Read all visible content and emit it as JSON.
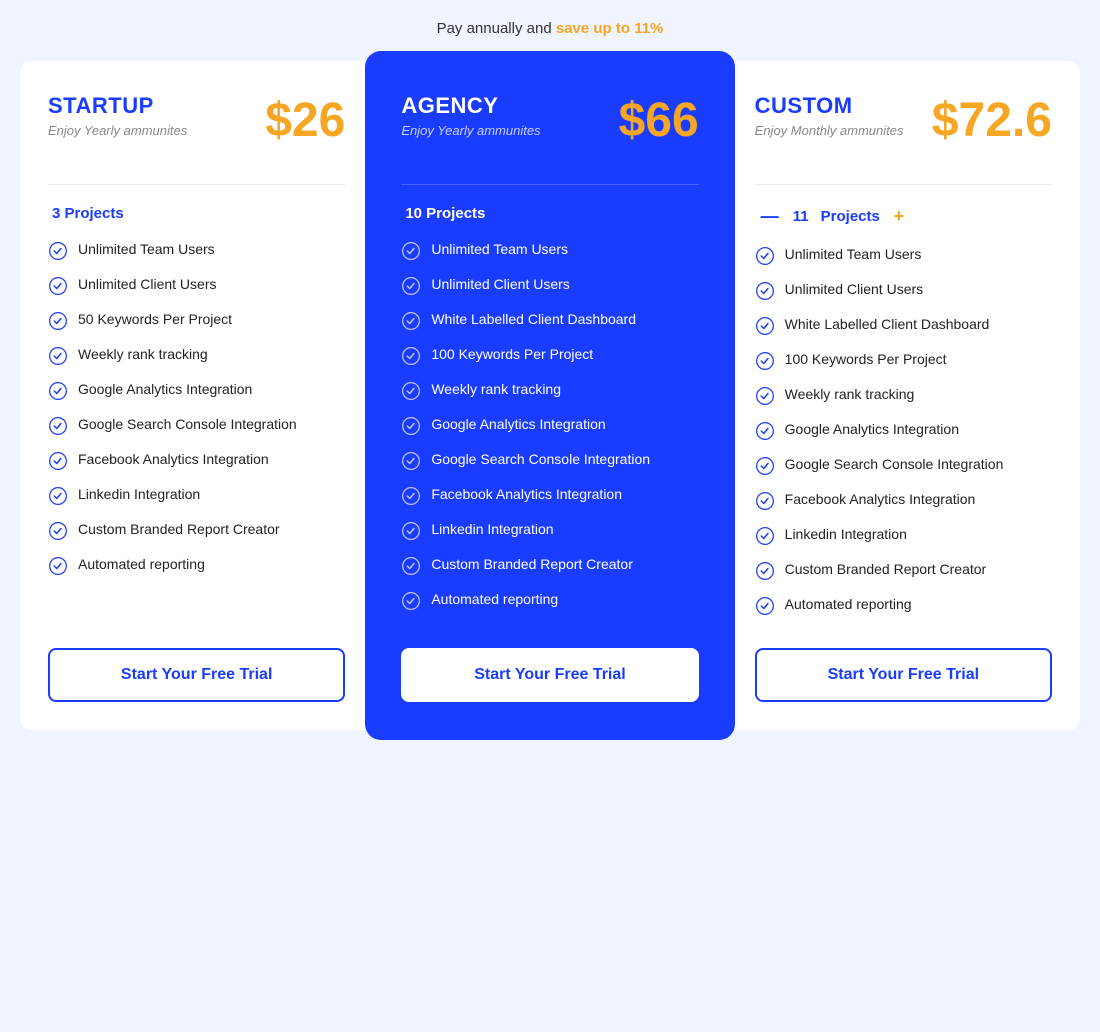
{
  "topbar": {
    "text": "Pay annually and",
    "save_text": "save up to 11%"
  },
  "plans": [
    {
      "id": "startup",
      "name": "STARTUP",
      "subtitle": "Enjoy Yearly ammunites",
      "price": "$26",
      "projects_label": "3 Projects",
      "projects_count": null,
      "has_controls": false,
      "features": [
        "Unlimited Team Users",
        "Unlimited Client Users",
        "50 Keywords Per Project",
        "Weekly rank tracking",
        "Google Analytics Integration",
        "Google Search Console Integration",
        "Facebook Analytics Integration",
        "Linkedin Integration",
        "Custom Branded Report Creator",
        "Automated reporting"
      ],
      "cta": "Start Your Free Trial"
    },
    {
      "id": "agency",
      "name": "AGENCY",
      "subtitle": "Enjoy Yearly ammunites",
      "price": "$66",
      "projects_label": "10 Projects",
      "projects_count": null,
      "has_controls": false,
      "features": [
        "Unlimited Team Users",
        "Unlimited Client Users",
        "White Labelled Client Dashboard",
        "100 Keywords Per Project",
        "Weekly rank tracking",
        "Google Analytics Integration",
        "Google Search Console Integration",
        "Facebook Analytics Integration",
        "Linkedin Integration",
        "Custom Branded Report Creator",
        "Automated reporting"
      ],
      "cta": "Start Your Free Trial"
    },
    {
      "id": "custom",
      "name": "CUSTOM",
      "subtitle": "Enjoy Monthly ammunites",
      "price": "$72.6",
      "projects_label": "Projects",
      "projects_count": 11,
      "has_controls": true,
      "features": [
        "Unlimited Team Users",
        "Unlimited Client Users",
        "White Labelled Client Dashboard",
        "100 Keywords Per Project",
        "Weekly rank tracking",
        "Google Analytics Integration",
        "Google Search Console Integration",
        "Facebook Analytics Integration",
        "Linkedin Integration",
        "Custom Branded Report Creator",
        "Automated reporting"
      ],
      "cta": "Start Your Free Trial"
    }
  ],
  "icons": {
    "check": "✓",
    "minus": "—",
    "plus": "+"
  }
}
